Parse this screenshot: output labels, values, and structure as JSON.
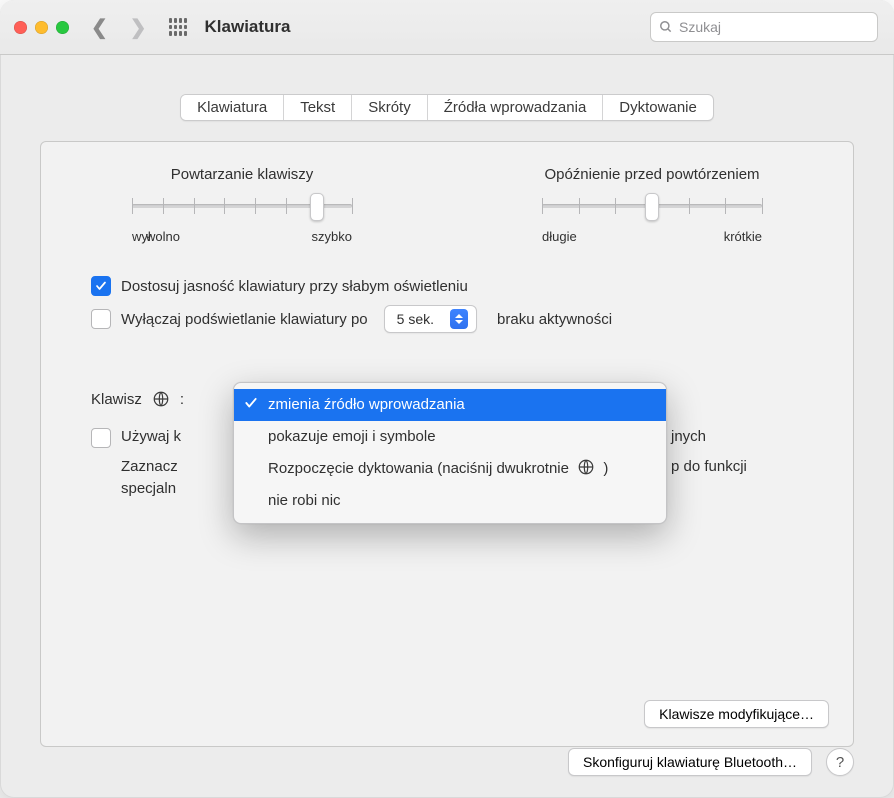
{
  "titlebar": {
    "title": "Klawiatura",
    "search_placeholder": "Szukaj"
  },
  "tabs": {
    "t0": "Klawiatura",
    "t1": "Tekst",
    "t2": "Skróty",
    "t3": "Źródła wprowadzania",
    "t4": "Dyktowanie"
  },
  "sliders": {
    "repeat": {
      "title": "Powtarzanie klawiszy",
      "left": "wył.",
      "mid": "wolno",
      "right": "szybko",
      "value_pct": 84
    },
    "delay": {
      "title": "Opóźnienie przed powtórzeniem",
      "left": "długie",
      "right": "krótkie",
      "value_pct": 50
    }
  },
  "options": {
    "adjust_brightness": "Dostosuj jasność klawiatury przy słabym oświetleniu",
    "backlight_off_prefix": "Wyłączaj podświetlanie klawiatury po",
    "backlight_value": "5 sek.",
    "backlight_off_suffix": "braku aktywności",
    "globe_key_label": "Klawisz",
    "globe_key_colon": ":",
    "use_keys_prefix": "Używaj k",
    "use_keys_right_tail": "jnych",
    "desc_line1_left": "Zaznacz",
    "desc_line1_right": "p do funkcji",
    "desc_line2_left": "specjaln"
  },
  "dropdown": {
    "opt0": "zmienia źródło wprowadzania",
    "opt1": "pokazuje emoji i symbole",
    "opt2_prefix": "Rozpoczęcie dyktowania (naciśnij dwukrotnie",
    "opt2_suffix": ")",
    "opt3": "nie robi nic"
  },
  "buttons": {
    "modifiers": "Klawisze modyfikujące…",
    "bluetooth": "Skonfiguruj klawiaturę Bluetooth…"
  }
}
